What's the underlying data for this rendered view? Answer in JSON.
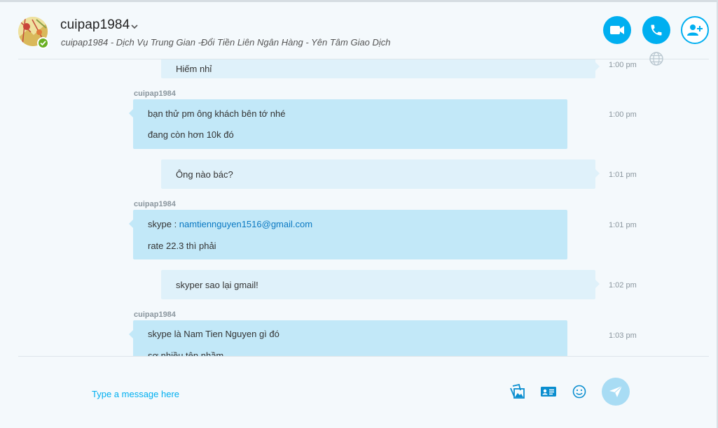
{
  "header": {
    "contact_name": "cuipap1984",
    "mood": "cuipap1984 - Dịch Vụ Trung Gian -Đổi Tiền Liên Ngân Hàng - Yên Tâm Giao Dịch",
    "buttons": {
      "video": "video-call-icon",
      "call": "phone-call-icon",
      "add_people": "add-person-icon"
    }
  },
  "messages": [
    {
      "direction": "out",
      "lines": [
        "Hiếm nhỉ"
      ],
      "time": "1:00 pm"
    },
    {
      "direction": "in",
      "sender": "cuipap1984",
      "lines": [
        "bạn thử pm ông khách bên tớ nhé",
        "đang còn hơn 10k đó"
      ],
      "time": "1:00 pm"
    },
    {
      "direction": "out",
      "lines": [
        "Ông nào bác?"
      ],
      "time": "1:01 pm"
    },
    {
      "direction": "in",
      "sender": "cuipap1984",
      "lines_prefix": "skype : ",
      "link": "namtiennguyen1516@gmail.com",
      "lines": [
        "rate 22.3 thì phải"
      ],
      "time": "1:01 pm"
    },
    {
      "direction": "out",
      "lines": [
        "skyper sao lại gmail!"
      ],
      "time": "1:02 pm"
    },
    {
      "direction": "in",
      "sender": "cuipap1984",
      "lines": [
        "skype là Nam Tien Nguyen gì đó",
        "sợ nhiều tên nhầm"
      ],
      "time": "1:03 pm"
    }
  ],
  "composer": {
    "placeholder": "Type a message here",
    "icons": [
      "media-gallery-icon",
      "contact-card-icon",
      "emoticon-icon",
      "send-icon"
    ]
  },
  "colors": {
    "accent": "#00aff0",
    "incoming_bubble": "#c2e8f8",
    "outgoing_bubble": "#dff1fa",
    "presence": "#6ab023"
  }
}
